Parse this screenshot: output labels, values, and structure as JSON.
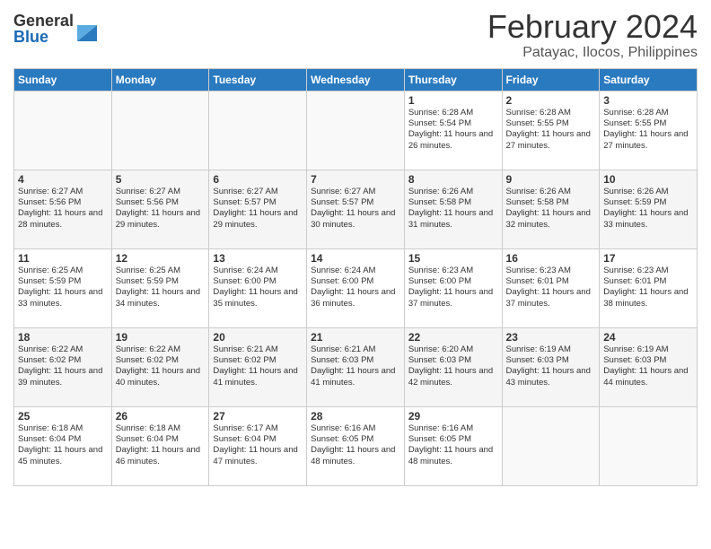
{
  "header": {
    "logo_general": "General",
    "logo_blue": "Blue",
    "month_title": "February 2024",
    "location": "Patayac, Ilocos, Philippines"
  },
  "days_of_week": [
    "Sunday",
    "Monday",
    "Tuesday",
    "Wednesday",
    "Thursday",
    "Friday",
    "Saturday"
  ],
  "weeks": [
    [
      {
        "day": "",
        "info": ""
      },
      {
        "day": "",
        "info": ""
      },
      {
        "day": "",
        "info": ""
      },
      {
        "day": "",
        "info": ""
      },
      {
        "day": "1",
        "info": "Sunrise: 6:28 AM\nSunset: 5:54 PM\nDaylight: 11 hours and 26 minutes."
      },
      {
        "day": "2",
        "info": "Sunrise: 6:28 AM\nSunset: 5:55 PM\nDaylight: 11 hours and 27 minutes."
      },
      {
        "day": "3",
        "info": "Sunrise: 6:28 AM\nSunset: 5:55 PM\nDaylight: 11 hours and 27 minutes."
      }
    ],
    [
      {
        "day": "4",
        "info": "Sunrise: 6:27 AM\nSunset: 5:56 PM\nDaylight: 11 hours and 28 minutes."
      },
      {
        "day": "5",
        "info": "Sunrise: 6:27 AM\nSunset: 5:56 PM\nDaylight: 11 hours and 29 minutes."
      },
      {
        "day": "6",
        "info": "Sunrise: 6:27 AM\nSunset: 5:57 PM\nDaylight: 11 hours and 29 minutes."
      },
      {
        "day": "7",
        "info": "Sunrise: 6:27 AM\nSunset: 5:57 PM\nDaylight: 11 hours and 30 minutes."
      },
      {
        "day": "8",
        "info": "Sunrise: 6:26 AM\nSunset: 5:58 PM\nDaylight: 11 hours and 31 minutes."
      },
      {
        "day": "9",
        "info": "Sunrise: 6:26 AM\nSunset: 5:58 PM\nDaylight: 11 hours and 32 minutes."
      },
      {
        "day": "10",
        "info": "Sunrise: 6:26 AM\nSunset: 5:59 PM\nDaylight: 11 hours and 33 minutes."
      }
    ],
    [
      {
        "day": "11",
        "info": "Sunrise: 6:25 AM\nSunset: 5:59 PM\nDaylight: 11 hours and 33 minutes."
      },
      {
        "day": "12",
        "info": "Sunrise: 6:25 AM\nSunset: 5:59 PM\nDaylight: 11 hours and 34 minutes."
      },
      {
        "day": "13",
        "info": "Sunrise: 6:24 AM\nSunset: 6:00 PM\nDaylight: 11 hours and 35 minutes."
      },
      {
        "day": "14",
        "info": "Sunrise: 6:24 AM\nSunset: 6:00 PM\nDaylight: 11 hours and 36 minutes."
      },
      {
        "day": "15",
        "info": "Sunrise: 6:23 AM\nSunset: 6:00 PM\nDaylight: 11 hours and 37 minutes."
      },
      {
        "day": "16",
        "info": "Sunrise: 6:23 AM\nSunset: 6:01 PM\nDaylight: 11 hours and 37 minutes."
      },
      {
        "day": "17",
        "info": "Sunrise: 6:23 AM\nSunset: 6:01 PM\nDaylight: 11 hours and 38 minutes."
      }
    ],
    [
      {
        "day": "18",
        "info": "Sunrise: 6:22 AM\nSunset: 6:02 PM\nDaylight: 11 hours and 39 minutes."
      },
      {
        "day": "19",
        "info": "Sunrise: 6:22 AM\nSunset: 6:02 PM\nDaylight: 11 hours and 40 minutes."
      },
      {
        "day": "20",
        "info": "Sunrise: 6:21 AM\nSunset: 6:02 PM\nDaylight: 11 hours and 41 minutes."
      },
      {
        "day": "21",
        "info": "Sunrise: 6:21 AM\nSunset: 6:03 PM\nDaylight: 11 hours and 41 minutes."
      },
      {
        "day": "22",
        "info": "Sunrise: 6:20 AM\nSunset: 6:03 PM\nDaylight: 11 hours and 42 minutes."
      },
      {
        "day": "23",
        "info": "Sunrise: 6:19 AM\nSunset: 6:03 PM\nDaylight: 11 hours and 43 minutes."
      },
      {
        "day": "24",
        "info": "Sunrise: 6:19 AM\nSunset: 6:03 PM\nDaylight: 11 hours and 44 minutes."
      }
    ],
    [
      {
        "day": "25",
        "info": "Sunrise: 6:18 AM\nSunset: 6:04 PM\nDaylight: 11 hours and 45 minutes."
      },
      {
        "day": "26",
        "info": "Sunrise: 6:18 AM\nSunset: 6:04 PM\nDaylight: 11 hours and 46 minutes."
      },
      {
        "day": "27",
        "info": "Sunrise: 6:17 AM\nSunset: 6:04 PM\nDaylight: 11 hours and 47 minutes."
      },
      {
        "day": "28",
        "info": "Sunrise: 6:16 AM\nSunset: 6:05 PM\nDaylight: 11 hours and 48 minutes."
      },
      {
        "day": "29",
        "info": "Sunrise: 6:16 AM\nSunset: 6:05 PM\nDaylight: 11 hours and 48 minutes."
      },
      {
        "day": "",
        "info": ""
      },
      {
        "day": "",
        "info": ""
      }
    ]
  ]
}
